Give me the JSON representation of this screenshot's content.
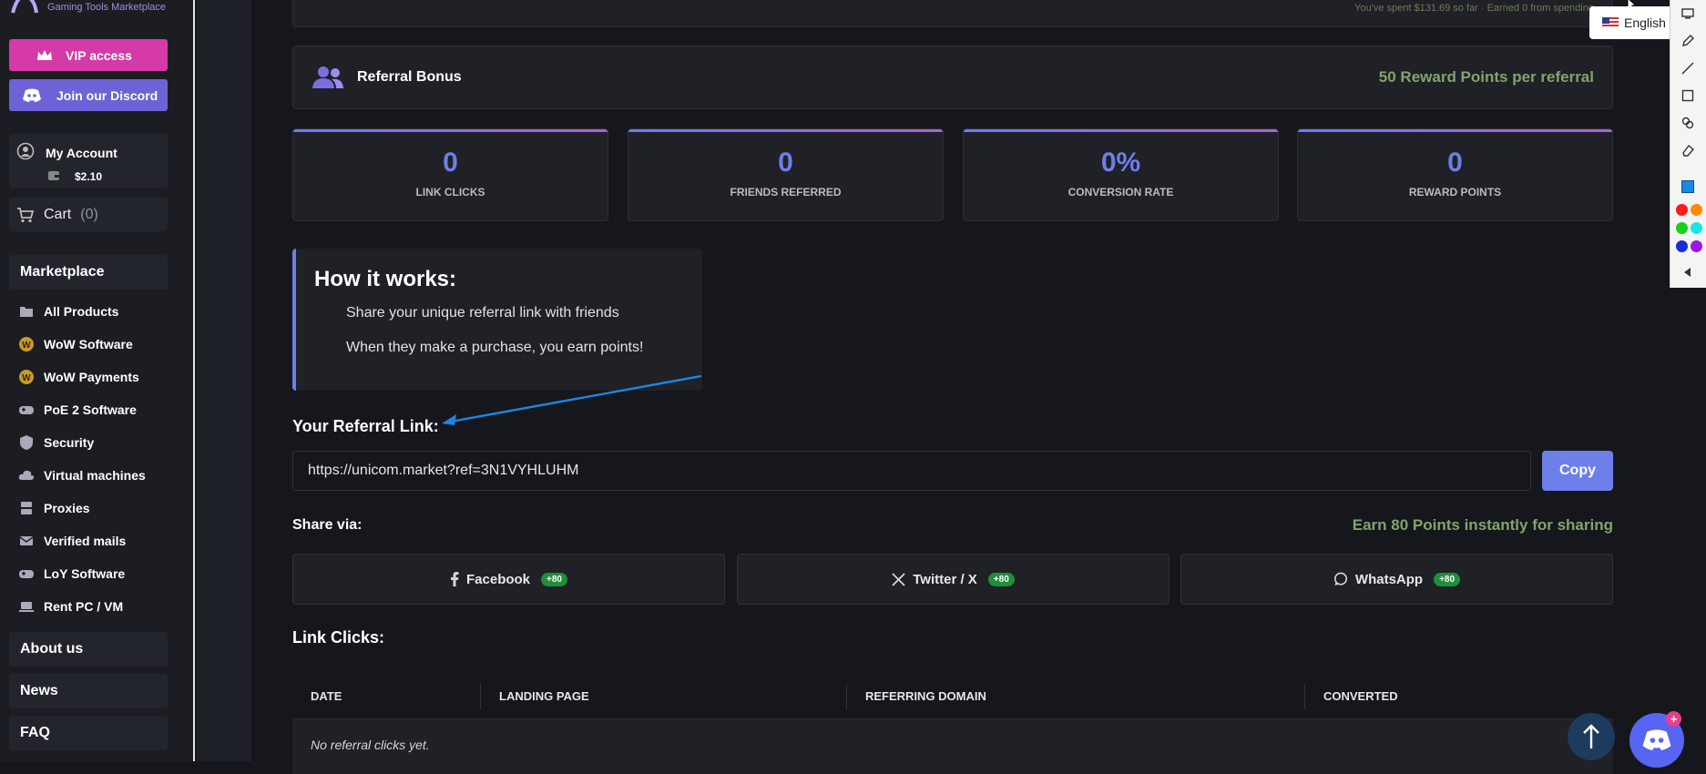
{
  "brand": {
    "subtitle": "Gaming Tools Marketplace"
  },
  "sidebar": {
    "vip_label": "VIP access",
    "discord_label": "Join our Discord",
    "account_label": "My Account",
    "balance": "$2.10",
    "cart_label": "Cart",
    "cart_count": "(0)",
    "marketplace_label": "Marketplace",
    "items": [
      {
        "label": "All Products",
        "icon": "folder-icon"
      },
      {
        "label": "WoW Software",
        "icon": "wow-icon"
      },
      {
        "label": "WoW Payments",
        "icon": "wow-icon"
      },
      {
        "label": "PoE 2 Software",
        "icon": "gamepad-icon"
      },
      {
        "label": "Security",
        "icon": "shield-icon"
      },
      {
        "label": "Virtual machines",
        "icon": "cloud-icon"
      },
      {
        "label": "Proxies",
        "icon": "server-icon"
      },
      {
        "label": "Verified mails",
        "icon": "mail-icon"
      },
      {
        "label": "LoY Software",
        "icon": "gamepad-icon"
      },
      {
        "label": "Rent PC / VM",
        "icon": "laptop-icon"
      }
    ],
    "about_label": "About us",
    "news_label": "News",
    "faq_label": "FAQ"
  },
  "top_stub": {
    "text": "You've spent $131.69 so far · Earned 0 from spending"
  },
  "referral": {
    "title": "Referral Bonus",
    "per_referral": "50 Reward Points per referral"
  },
  "stats": [
    {
      "value": "0",
      "label": "LINK CLICKS"
    },
    {
      "value": "0",
      "label": "FRIENDS REFERRED"
    },
    {
      "value": "0%",
      "label": "CONVERSION RATE"
    },
    {
      "value": "0",
      "label": "REWARD POINTS"
    }
  ],
  "how": {
    "title": "How it works:",
    "step1": "Share your unique referral link with friends",
    "step2": "When they make a purchase, you earn points!"
  },
  "link": {
    "label": "Your Referral Link:",
    "url": "https://unicom.market?ref=3N1VYHLUHM",
    "copy_label": "Copy"
  },
  "share": {
    "label": "Share via:",
    "earn": "Earn 80 Points instantly for sharing",
    "buttons": [
      {
        "label": "Facebook",
        "badge": "+80"
      },
      {
        "label": "Twitter / X",
        "badge": "+80"
      },
      {
        "label": "WhatsApp",
        "badge": "+80"
      }
    ]
  },
  "clicks": {
    "label": "Link Clicks:",
    "columns": [
      "DATE",
      "LANDING PAGE",
      "REFERRING DOMAIN",
      "CONVERTED"
    ],
    "empty": "No referral clicks yet."
  },
  "overlay": {
    "language": "English",
    "discord_badge": "+"
  },
  "colors": {
    "accent": "#6d7fe8",
    "vip": "#d63aa8",
    "discord": "#6d63d6",
    "green_text": "#83a36b",
    "badge_green": "#1f8f3a"
  }
}
